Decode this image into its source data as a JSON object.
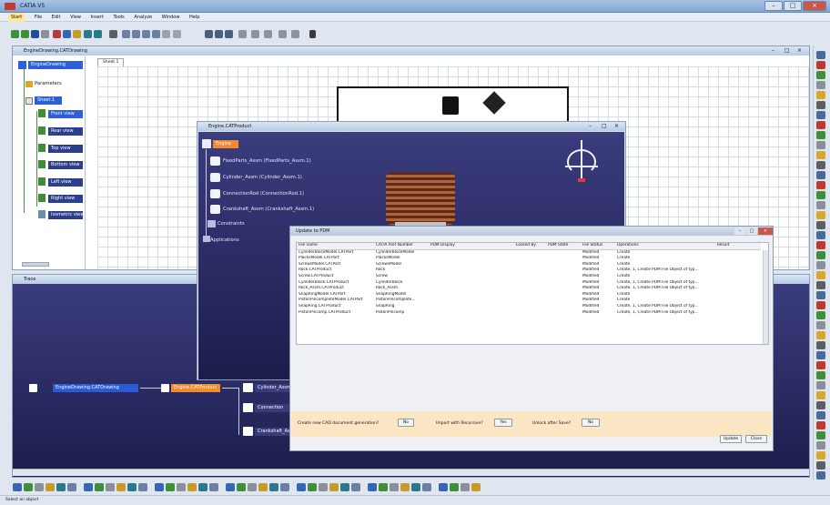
{
  "app": {
    "title": "CATIA V5",
    "win_controls": [
      "–",
      "□",
      "×"
    ]
  },
  "menu": [
    "Start",
    "File",
    "Edit",
    "View",
    "Insert",
    "Tools",
    "Analyze",
    "Window",
    "Help"
  ],
  "drawing_window": {
    "title": "EngineDrawing.CATDrawing",
    "sheet_tab": "Sheet.1",
    "tree": [
      "EngineDrawing",
      "Parameters",
      "Sheet.1",
      "Front view",
      "Rear view",
      "Top view",
      "Bottom view",
      "Left view",
      "Right view",
      "Isometric view"
    ],
    "win_controls": [
      "–",
      "□",
      "×"
    ]
  },
  "lower_window": {
    "title": "Trace",
    "nodes": [
      "EngineDrawing.CATDrawing",
      "Engine.CATProduct",
      "Cylinder_Assm",
      "Connection",
      "Crankshaft_Assm"
    ]
  },
  "product_window": {
    "title": "Engine.CATProduct",
    "tree": [
      "Engine",
      "FixedParts_Assm (FixedParts_Assm.1)",
      "Cylinder_Assm (Cylinder_Assm.1)",
      "ConnectionRod (ConnectionRod.1)",
      "Crankshaft_Assm (Crankshaft_Assm.1)",
      "Constraints",
      "Applications"
    ],
    "win_controls": [
      "–",
      "□",
      "×"
    ]
  },
  "dialog": {
    "title": "Update to PDM",
    "columns": [
      "File name",
      "CATIA Part Number",
      "PDM Display",
      "Locked By",
      "PDM State",
      "File Status",
      "Operations",
      "Result"
    ],
    "rows": [
      [
        "CylinderBlockModel.CATPart",
        "CylinderBlockModel",
        "",
        "",
        "",
        "Modified",
        "Create",
        ""
      ],
      [
        "PlacksModel.CATPart",
        "PlacksModel",
        "",
        "",
        "",
        "Modified",
        "Create",
        ""
      ],
      [
        "ScrewsModel.CATPart",
        "ScrewsModel",
        "",
        "",
        "",
        "Modified",
        "Create",
        ""
      ],
      [
        "Rock.CATProduct",
        "Rock",
        "",
        "",
        "",
        "Modified",
        "Create, 1, Create PDM File Object of typ...",
        ""
      ],
      [
        "Screw.CATProduct",
        "Screw",
        "",
        "",
        "",
        "Modified",
        "Create",
        ""
      ],
      [
        "CylinderBlock.CATProduct",
        "CylinderBlock",
        "",
        "",
        "",
        "Modified",
        "Create, 1, Create PDM File Object of typ...",
        ""
      ],
      [
        "Rock_Assm.CATProduct",
        "Rock_Assm",
        "",
        "",
        "",
        "Modified",
        "Create, 1, Create PDM File Object of typ...",
        ""
      ],
      [
        "SnapRingModel.CATPart",
        "SnapRingModel",
        "",
        "",
        "",
        "Modified",
        "Create",
        ""
      ],
      [
        "PistonPincompleteModel.CATPart",
        "PistonPincomplete...",
        "",
        "",
        "",
        "Modified",
        "Create",
        ""
      ],
      [
        "SnapRing.CATProduct",
        "SnapRing",
        "",
        "",
        "",
        "Modified",
        "Create, 1, Create PDM File Object of typ...",
        ""
      ],
      [
        "PistonPincomp.CATProduct",
        "PistonPincomp",
        "",
        "",
        "",
        "Modified",
        "Create, 1, Create PDM File Object of typ...",
        ""
      ]
    ],
    "opt1_label": "Create new CAD document generation?",
    "opt1_value": "No",
    "opt2_label": "Import with Recursive?",
    "opt2_value": "Yes",
    "opt3_label": "Unlock after Save?",
    "opt3_value": "No",
    "update_button": "Update",
    "close_button": "Close",
    "win_controls": [
      "–",
      "□",
      "×"
    ]
  },
  "status": "Select an object"
}
